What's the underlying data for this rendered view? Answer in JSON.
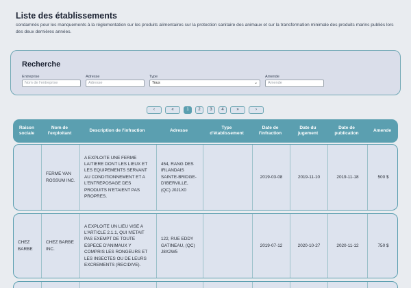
{
  "header": {
    "title": "Liste des établissements",
    "subtitle": "condamnés pour les manquements à la réglementation sur les produits alimentaires sur la protection sanitaire des animaux et sur la transformation minimale des produits marins publiés lors des deux dernières années."
  },
  "search": {
    "title": "Recherche",
    "fields": [
      {
        "label": "Entreprise",
        "placeholder": "Nom de l'entreprise"
      },
      {
        "label": "Adresse",
        "placeholder": "Adresse"
      },
      {
        "label": "Type",
        "value": "Tous"
      },
      {
        "label": "Amende",
        "placeholder": "Amende"
      }
    ]
  },
  "pagination": {
    "prev": "‹",
    "first": "«",
    "pages": [
      "1",
      "2",
      "3",
      "4"
    ],
    "current": "1",
    "last": "»",
    "next": "›"
  },
  "table": {
    "columns": [
      "Raison sociale",
      "Nom de l'exploitant",
      "Description de l'infraction",
      "Adresse",
      "Type d'établissement",
      "Date de l'infraction",
      "Date du jugement",
      "Date de publication",
      "Amende"
    ],
    "rows": [
      {
        "raison": "",
        "exploitant": "FERME VAN ROSSUM INC.",
        "description": "A EXPLOITE UNE FERME LAITIERE DONT LES LIEUX ET LES EQUIPEMENTS SERVANT AU CONDITIONNEMENT ET A L'ENTREPOSAGE DES PRODUITS N'ETAIENT PAS PROPRES.",
        "adresse": "454, RANG DES IRLANDAIS SAINTE-BRIDGE-D'IBERVILLE, (QC) J0J1X0",
        "type": "",
        "date_infraction": "2019-03-08",
        "date_jugement": "2019-11-10",
        "date_publication": "2019-11-18",
        "amende": "500 $"
      },
      {
        "raison": "CHEZ BARBE",
        "exploitant": "CHEZ BARBE INC.",
        "description": "A EXPLOITE UN LIEU VISE A L'ARTICLE 2.1.1, QUI N'ETAIT PAS EXEMPT DE TOUTE ESPECE D'ANIMAUX Y COMPRIS LES RONGEURS ET LES INSECTES OU DE LEURS EXCREMENTS (RECIDIVE).",
        "adresse": "122, RUE EDDY GATINEAU, (QC) J8X2W5",
        "type": "",
        "date_infraction": "2019-07-12",
        "date_jugement": "2020-10-27",
        "date_publication": "2020-11-12",
        "amende": "750 $"
      }
    ]
  }
}
